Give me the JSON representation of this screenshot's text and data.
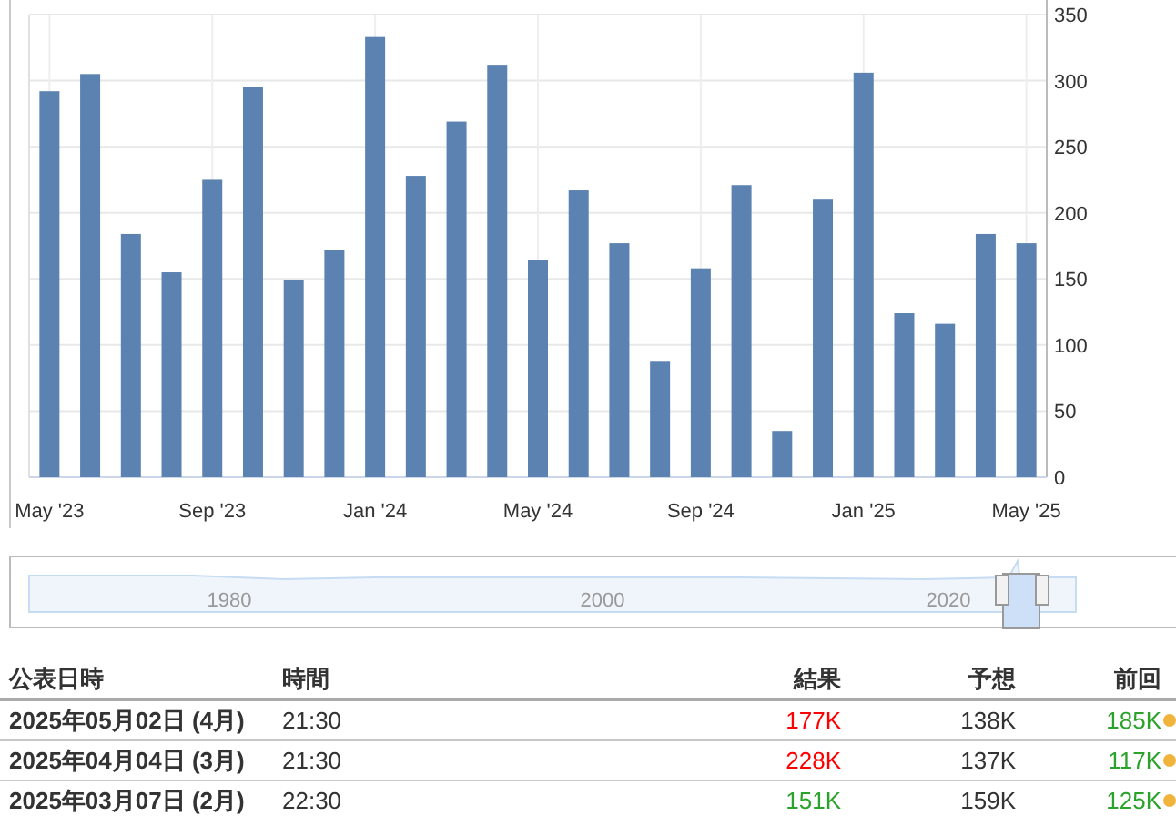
{
  "chart": {
    "chart_data": {
      "type": "bar",
      "categories": [
        "May '23",
        null,
        null,
        null,
        "Sep '23",
        null,
        null,
        null,
        "Jan '24",
        null,
        null,
        null,
        "May '24",
        null,
        null,
        null,
        "Sep '24",
        null,
        null,
        null,
        "Jan '25",
        null,
        null,
        null,
        "May '25"
      ],
      "values": [
        292,
        305,
        184,
        155,
        225,
        295,
        149,
        172,
        333,
        228,
        269,
        312,
        164,
        217,
        177,
        88,
        158,
        221,
        35,
        210,
        306,
        124,
        116,
        184,
        177
      ],
      "ylim": [
        0,
        350
      ],
      "yticks": [
        0,
        50,
        100,
        150,
        200,
        250,
        300,
        350
      ],
      "grid": true
    }
  },
  "navigator": {
    "labels": [
      "1980",
      "2000",
      "2020"
    ]
  },
  "table": {
    "columns": [
      "公表日時",
      "時間",
      "結果",
      "予想",
      "前回"
    ],
    "rows": [
      {
        "date": "2025年05月02日 (4月)",
        "time": "21:30",
        "result": {
          "text": "177K",
          "color": "#ff0000"
        },
        "forecast": "138K",
        "previous": {
          "text": "185K",
          "color": "#2aa32a"
        },
        "marker": {
          "color": "#f0b43c"
        }
      },
      {
        "date": "2025年04月04日 (3月)",
        "time": "21:30",
        "result": {
          "text": "228K",
          "color": "#ff0000"
        },
        "forecast": "137K",
        "previous": {
          "text": "117K",
          "color": "#2aa32a"
        },
        "marker": {
          "color": "#f0b43c"
        }
      },
      {
        "date": "2025年03月07日 (2月)",
        "time": "22:30",
        "result": {
          "text": "151K",
          "color": "#2aa32a"
        },
        "forecast": "159K",
        "previous": {
          "text": "125K",
          "color": "#2aa32a"
        },
        "marker": {
          "color": "#f0b43c"
        }
      }
    ]
  }
}
